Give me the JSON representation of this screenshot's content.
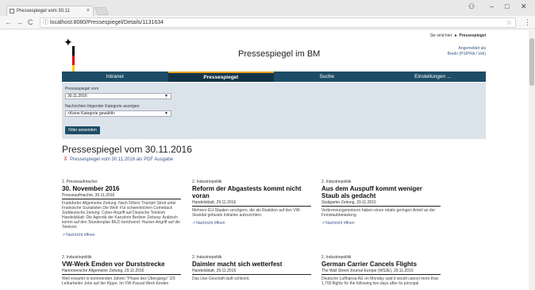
{
  "browser": {
    "tab_title": "Pressespiegel vom 30.11",
    "tab_close": "×",
    "url": "localhost:8080/Pressespiegel/Details/1131634",
    "controls": {
      "minimize": "–",
      "maximize": "□",
      "close": "✕",
      "account": "⚇"
    }
  },
  "header": {
    "title": "Pressespiegel im BM",
    "where_label": "Sie sind hier:",
    "where_value": "► Pressespiegel",
    "user_line1": "Angemeldet als",
    "user_line2": "Bredo (PS/PRA / Veli)"
  },
  "nav": {
    "items": [
      {
        "label": "Intranet"
      },
      {
        "label": "Pressespiegel"
      },
      {
        "label": "Suche"
      },
      {
        "label": "Einstellungen ..."
      }
    ]
  },
  "filter": {
    "date_label": "Pressespiegel vom",
    "date_value": "30.11.2016",
    "category_label": "Nachrichten folgender Kategorie anzeigen",
    "category_value": "<Keine Kategorie gewählt>",
    "apply_label": "Filter anwenden"
  },
  "main": {
    "heading": "Pressespiegel vom 30.11.2016",
    "pdf_link": "Pressespiegel vom 30.11.2016 als PDF Ausgabe"
  },
  "articles": [
    {
      "category": "1. Presseaufmacher",
      "title": "30. November 2016",
      "source": "Presseaufmacher, 30.11.2016",
      "text": "Frankfurter Allgemeine Zeitung: Nach Fillons Triumph Streit unter Frankische Sozialisten Die Welt: Für schwerköchen Comeback Süddeutsche Zeitung: Cyber-Angriff auf Deutsche Telekom Handelsblatt: Die Agenda der Kanzlerin Berliner Zeitung: Arabisch komm auf den Stundenplan BILD berührend: Hacker-Angriff auf die Telekom",
      "link": "Nachricht öffnen"
    },
    {
      "category": "2. Industriepolitik",
      "title": "Reform der Abgastests kommt nicht voran",
      "source": "Handelsblatt, 29.11.2016",
      "text": "Mehrere EU-Staaten verzögern, die als Reaktion auf den VW-Skandal gefasste Initiative aufzurichten.",
      "link": "Nachricht öffnen"
    },
    {
      "category": "2. Industriepolitik",
      "title": "Aus dem Auspuff kommt weniger Staub als gedacht",
      "source": "Stuttgarter Zeitung, 29.11.2016",
      "text": "Verbrennungsmotoren haben einen relativ geringen Anteil an der Feinstaubbelastung.",
      "link": "Nachricht öffnen"
    },
    {
      "category": "2. Industriepolitik",
      "title": "VW-Werk Emden vor Durststrecke",
      "source": "Hannoversche Allgemeine Zeitung, 29.11.2016",
      "text": "Weil erwartet in kommenden Jahren \"Phase des Übergangs\" 2/3 Leiharbeiter Jobs auf der Kippe. Im VW-Passat Werk Emden",
      "link": ""
    },
    {
      "category": "2. Industriepolitik",
      "title": "Daimler macht sich wetterfest",
      "source": "Handelsblatt, 29.11.2016",
      "text": "Das Lkw-Geschäft läuft schlecht.",
      "link": ""
    },
    {
      "category": "2. Industriepolitik",
      "title": "German Carrier Cancels Flights",
      "source": "The Wall Street Journal Europe (WSJE), 29.11.2016",
      "text": "Deutsche Lufthansa AG on Monday said it would cancel more than 1,700 flights for the following two days after its principal",
      "link": ""
    }
  ],
  "colors": {
    "nav_bg": "#1d4d66",
    "nav_active": "#123347",
    "accent": "#e8a21a",
    "filter_bg": "#dbe3ea",
    "link": "#3a5a8a"
  }
}
